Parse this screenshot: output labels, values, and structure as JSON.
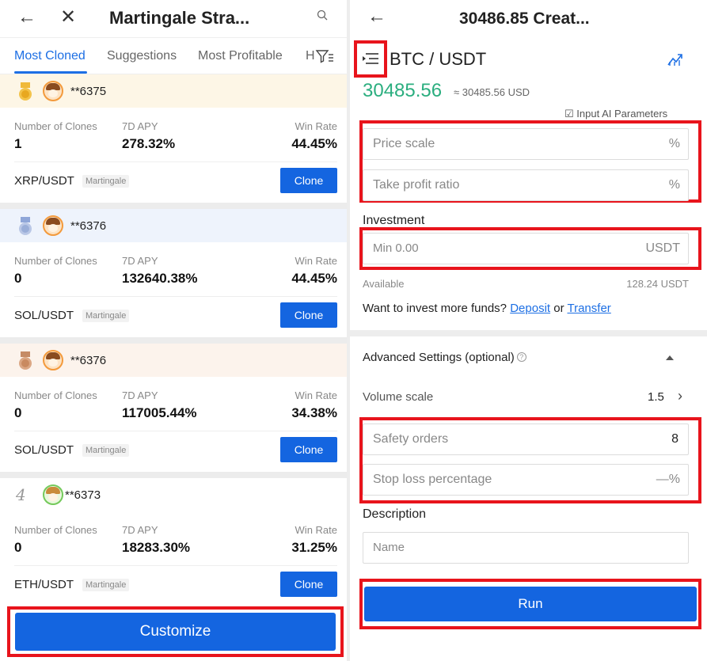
{
  "left": {
    "header": {
      "back_icon": "arrow-left-icon",
      "close_icon": "close-icon",
      "title": "Martingale Stra...",
      "search_icon": "search-icon"
    },
    "tabs": [
      "Most Cloned",
      "Suggestions",
      "Most Profitable",
      "H"
    ],
    "labels": {
      "clones": "Number of Clones",
      "apy": "7D APY",
      "win": "Win Rate",
      "clone_btn": "Clone",
      "tag": "Martingale"
    },
    "cards": [
      {
        "rank": "gold",
        "user": "**6375",
        "clones": "1",
        "apy": "278.32%",
        "win": "44.45%",
        "pair": "XRP/USDT",
        "bg": "#fdf6e6"
      },
      {
        "rank": "silver",
        "user": "**6376",
        "clones": "0",
        "apy": "132640.38%",
        "win": "44.45%",
        "pair": "SOL/USDT",
        "bg": "#eef3fc"
      },
      {
        "rank": "bronze",
        "user": "**6376",
        "clones": "0",
        "apy": "117005.44%",
        "win": "34.38%",
        "pair": "SOL/USDT",
        "bg": "#fcf3ec"
      },
      {
        "rank": "4",
        "user": "**6373",
        "clones": "0",
        "apy": "18283.30%",
        "win": "31.25%",
        "pair": "ETH/USDT",
        "bg": "#ffffff"
      }
    ],
    "customize_label": "Customize"
  },
  "right": {
    "header": {
      "back_icon": "arrow-left-icon",
      "title": "30486.85 Creat..."
    },
    "pair": "BTC / USDT",
    "price": "30485.56",
    "price_usd": "≈ 30485.56 USD",
    "ai_params": "Input AI Parameters",
    "price_scale": {
      "placeholder": "Price scale",
      "suffix": "%"
    },
    "take_profit": {
      "placeholder": "Take profit ratio",
      "suffix": "%"
    },
    "investment_label": "Investment",
    "investment": {
      "placeholder": "Min 0.00",
      "suffix": "USDT"
    },
    "available_label": "Available",
    "available_value": "128.24 USDT",
    "funds_text": "Want to invest more funds?",
    "deposit": "Deposit",
    "or": "or",
    "transfer": "Transfer",
    "advanced": "Advanced Settings (optional)",
    "volume_scale_label": "Volume scale",
    "volume_scale_value": "1.5",
    "safety_orders": {
      "placeholder": "Safety orders",
      "value": "8"
    },
    "stop_loss": {
      "placeholder": "Stop loss percentage",
      "suffix": "—%"
    },
    "description_label": "Description",
    "name_placeholder": "Name",
    "run_label": "Run"
  },
  "colors": {
    "accent": "#1465e0",
    "price_green": "#2bae7f",
    "highlight_red": "#e8141c"
  }
}
